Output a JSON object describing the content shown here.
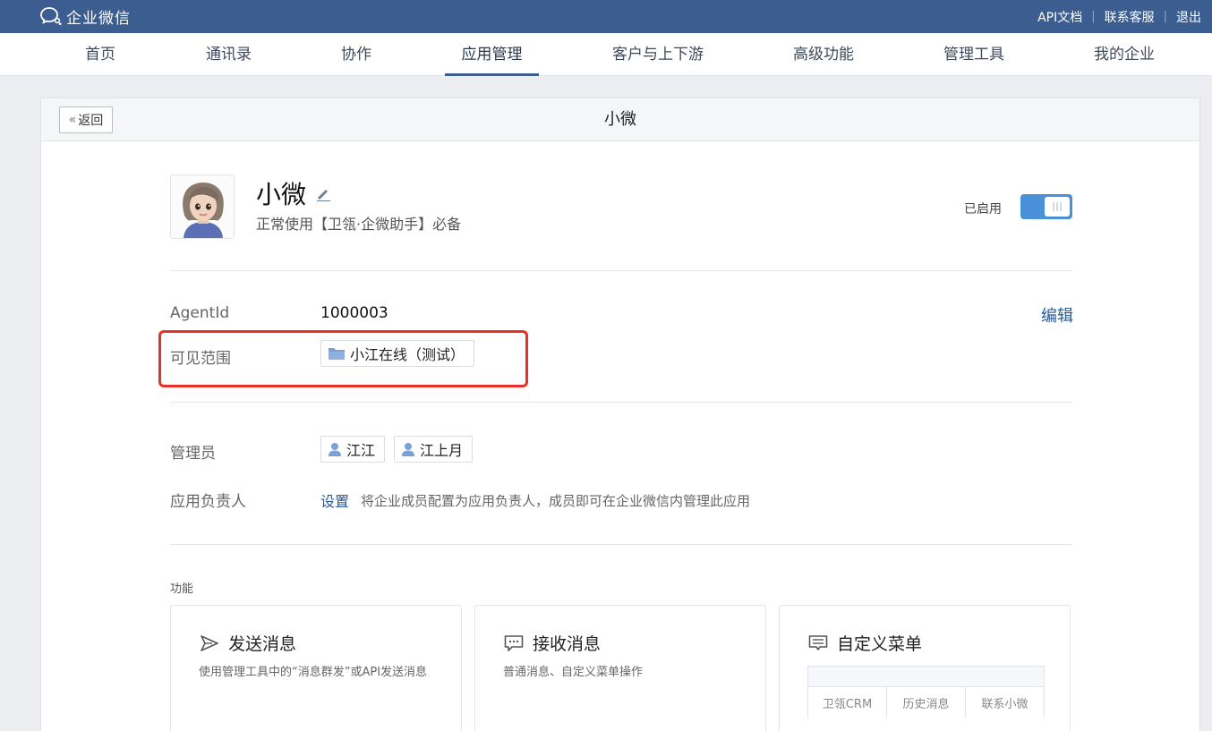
{
  "topbar": {
    "logo_text": "企业微信",
    "links": [
      "API文档",
      "联系客服",
      "退出"
    ]
  },
  "nav": {
    "items": [
      "首页",
      "通讯录",
      "协作",
      "应用管理",
      "客户与上下游",
      "高级功能",
      "管理工具",
      "我的企业"
    ],
    "active": "应用管理"
  },
  "header": {
    "back_label": "返回",
    "title": "小微"
  },
  "app": {
    "name": "小微",
    "description": "正常使用【卫瓴·企微助手】必备",
    "status_label": "已启用",
    "enabled": true
  },
  "details": {
    "agentid_label": "AgentId",
    "agentid_value": "1000003",
    "edit_label": "编辑",
    "visible_label": "可见范围",
    "visible_scope": "小江在线（测试）",
    "admin_label": "管理员",
    "admins": [
      "江江",
      "江上月"
    ],
    "owner_label": "应用负责人",
    "owner_set_label": "设置",
    "owner_hint": "将企业成员配置为应用负责人，成员即可在企业微信内管理此应用"
  },
  "features": {
    "section_label": "功能",
    "cards": [
      {
        "title": "发送消息",
        "desc": "使用管理工具中的“消息群发”或API发送消息",
        "icon": "send-icon"
      },
      {
        "title": "接收消息",
        "desc": "普通消息、自定义菜单操作",
        "icon": "chat-icon"
      },
      {
        "title": "自定义菜单",
        "icon": "menu-icon",
        "menu_items": [
          "卫瓴CRM",
          "历史消息",
          "联系小微"
        ]
      }
    ]
  },
  "colors": {
    "topbar": "#3b5d8f",
    "accent": "#4a90d9",
    "link": "#2a5a96",
    "highlight": "#e8302a"
  }
}
